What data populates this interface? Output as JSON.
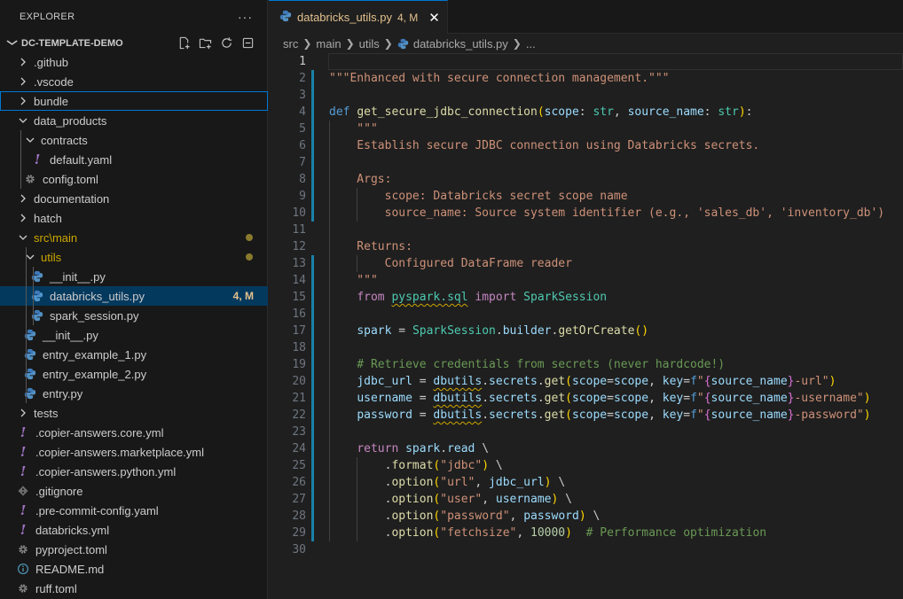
{
  "explorer": {
    "title": "EXPLORER",
    "more": "···",
    "project": "DC-TEMPLATE-DEMO",
    "project_actions": [
      "new-file-icon",
      "new-folder-icon",
      "refresh-icon",
      "collapse-all-icon"
    ]
  },
  "tree": [
    {
      "label": ".github",
      "type": "folder",
      "depth": 0,
      "expanded": false
    },
    {
      "label": ".vscode",
      "type": "folder",
      "depth": 0,
      "expanded": false
    },
    {
      "label": "bundle",
      "type": "folder",
      "depth": 0,
      "expanded": false,
      "focused": true
    },
    {
      "label": "data_products",
      "type": "folder",
      "depth": 0,
      "expanded": true
    },
    {
      "label": "contracts",
      "type": "folder",
      "depth": 1,
      "expanded": true
    },
    {
      "label": "default.yaml",
      "type": "yaml",
      "depth": 2
    },
    {
      "label": "config.toml",
      "type": "toml",
      "depth": 1
    },
    {
      "label": "documentation",
      "type": "folder",
      "depth": 0,
      "expanded": false
    },
    {
      "label": "hatch",
      "type": "folder",
      "depth": 0,
      "expanded": false
    },
    {
      "label": "src\\main",
      "type": "folder",
      "depth": 0,
      "expanded": true,
      "modified": true,
      "dot": true
    },
    {
      "label": "utils",
      "type": "folder",
      "depth": 1,
      "expanded": true,
      "modified": true,
      "dot": true
    },
    {
      "label": "__init__.py",
      "type": "py",
      "depth": 2
    },
    {
      "label": "databricks_utils.py",
      "type": "py",
      "depth": 2,
      "selected": true,
      "badge": "4, M"
    },
    {
      "label": "spark_session.py",
      "type": "py",
      "depth": 2
    },
    {
      "label": "__init__.py",
      "type": "py",
      "depth": 1
    },
    {
      "label": "entry_example_1.py",
      "type": "py",
      "depth": 1
    },
    {
      "label": "entry_example_2.py",
      "type": "py",
      "depth": 1
    },
    {
      "label": "entry.py",
      "type": "py",
      "depth": 1
    },
    {
      "label": "tests",
      "type": "folder",
      "depth": 0,
      "expanded": false
    },
    {
      "label": ".copier-answers.core.yml",
      "type": "yaml",
      "depth": 0
    },
    {
      "label": ".copier-answers.marketplace.yml",
      "type": "yaml",
      "depth": 0
    },
    {
      "label": ".copier-answers.python.yml",
      "type": "yaml",
      "depth": 0
    },
    {
      "label": ".gitignore",
      "type": "git",
      "depth": 0
    },
    {
      "label": ".pre-commit-config.yaml",
      "type": "yaml",
      "depth": 0
    },
    {
      "label": "databricks.yml",
      "type": "yaml",
      "depth": 0
    },
    {
      "label": "pyproject.toml",
      "type": "toml",
      "depth": 0
    },
    {
      "label": "README.md",
      "type": "info",
      "depth": 0
    },
    {
      "label": "ruff.toml",
      "type": "toml",
      "depth": 0
    }
  ],
  "tab": {
    "label": "databricks_utils.py",
    "badge": "4, M",
    "close": "✕"
  },
  "breadcrumb": [
    "src",
    "main",
    "utils",
    "databricks_utils.py",
    "..."
  ],
  "editor": {
    "current_line": 1,
    "lines": [
      [],
      [
        [
          "str",
          "\"\"\"Enhanced with secure connection management.\"\"\""
        ]
      ],
      [],
      [
        [
          "kw",
          "def"
        ],
        [
          "",
          " "
        ],
        [
          "fn",
          "get_secure_jdbc_connection"
        ],
        [
          "br1",
          "("
        ],
        [
          "prm",
          "scope"
        ],
        [
          "",
          ": "
        ],
        [
          "ty",
          "str"
        ],
        [
          "",
          ", "
        ],
        [
          "prm",
          "source_name"
        ],
        [
          "",
          ": "
        ],
        [
          "ty",
          "str"
        ],
        [
          "br1",
          ")"
        ],
        [
          "",
          ":"
        ]
      ],
      [
        [
          "str",
          "    \"\"\""
        ]
      ],
      [
        [
          "str",
          "    Establish secure JDBC connection using Databricks secrets."
        ]
      ],
      [],
      [
        [
          "str",
          "    Args:"
        ]
      ],
      [
        [
          "str",
          "        scope: Databricks secret scope name"
        ]
      ],
      [
        [
          "str",
          "        source_name: Source system identifier (e.g., 'sales_db', 'inventory_db')"
        ]
      ],
      [],
      [
        [
          "str",
          "    Returns:"
        ]
      ],
      [
        [
          "str",
          "        Configured DataFrame reader"
        ]
      ],
      [
        [
          "str",
          "    \"\"\""
        ]
      ],
      [
        [
          "",
          "    "
        ],
        [
          "kw2",
          "from"
        ],
        [
          "",
          " "
        ],
        [
          "ty sq",
          "pyspark.sql"
        ],
        [
          "",
          " "
        ],
        [
          "kw2",
          "import"
        ],
        [
          "",
          " "
        ],
        [
          "ty",
          "SparkSession"
        ]
      ],
      [],
      [
        [
          "",
          "    "
        ],
        [
          "prm",
          "spark"
        ],
        [
          "",
          " = "
        ],
        [
          "ty",
          "SparkSession"
        ],
        [
          "",
          "."
        ],
        [
          "prm",
          "builder"
        ],
        [
          "",
          "."
        ],
        [
          "fn",
          "getOrCreate"
        ],
        [
          "br1",
          "()"
        ]
      ],
      [],
      [
        [
          "cm",
          "    # Retrieve credentials from secrets (never hardcode!)"
        ]
      ],
      [
        [
          "",
          "    "
        ],
        [
          "prm",
          "jdbc_url"
        ],
        [
          "",
          " = "
        ],
        [
          "prm sq",
          "dbutils"
        ],
        [
          "",
          "."
        ],
        [
          "prm",
          "secrets"
        ],
        [
          "",
          "."
        ],
        [
          "fn",
          "get"
        ],
        [
          "br1",
          "("
        ],
        [
          "prm",
          "scope"
        ],
        [
          "",
          "="
        ],
        [
          "prm",
          "scope"
        ],
        [
          "",
          ", "
        ],
        [
          "prm",
          "key"
        ],
        [
          "",
          "="
        ],
        [
          "kw",
          "f"
        ],
        [
          "str",
          "\""
        ],
        [
          "br2",
          "{"
        ],
        [
          "prm",
          "source_name"
        ],
        [
          "br2",
          "}"
        ],
        [
          "str",
          "-url\""
        ],
        [
          "br1",
          ")"
        ]
      ],
      [
        [
          "",
          "    "
        ],
        [
          "prm",
          "username"
        ],
        [
          "",
          " = "
        ],
        [
          "prm sq",
          "dbutils"
        ],
        [
          "",
          "."
        ],
        [
          "prm",
          "secrets"
        ],
        [
          "",
          "."
        ],
        [
          "fn",
          "get"
        ],
        [
          "br1",
          "("
        ],
        [
          "prm",
          "scope"
        ],
        [
          "",
          "="
        ],
        [
          "prm",
          "scope"
        ],
        [
          "",
          ", "
        ],
        [
          "prm",
          "key"
        ],
        [
          "",
          "="
        ],
        [
          "kw",
          "f"
        ],
        [
          "str",
          "\""
        ],
        [
          "br2",
          "{"
        ],
        [
          "prm",
          "source_name"
        ],
        [
          "br2",
          "}"
        ],
        [
          "str",
          "-username\""
        ],
        [
          "br1",
          ")"
        ]
      ],
      [
        [
          "",
          "    "
        ],
        [
          "prm",
          "password"
        ],
        [
          "",
          " = "
        ],
        [
          "prm sq",
          "dbutils"
        ],
        [
          "",
          "."
        ],
        [
          "prm",
          "secrets"
        ],
        [
          "",
          "."
        ],
        [
          "fn",
          "get"
        ],
        [
          "br1",
          "("
        ],
        [
          "prm",
          "scope"
        ],
        [
          "",
          "="
        ],
        [
          "prm",
          "scope"
        ],
        [
          "",
          ", "
        ],
        [
          "prm",
          "key"
        ],
        [
          "",
          "="
        ],
        [
          "kw",
          "f"
        ],
        [
          "str",
          "\""
        ],
        [
          "br2",
          "{"
        ],
        [
          "prm",
          "source_name"
        ],
        [
          "br2",
          "}"
        ],
        [
          "str",
          "-password\""
        ],
        [
          "br1",
          ")"
        ]
      ],
      [],
      [
        [
          "",
          "    "
        ],
        [
          "kw2",
          "return"
        ],
        [
          "",
          " "
        ],
        [
          "prm",
          "spark"
        ],
        [
          "",
          "."
        ],
        [
          "prm",
          "read"
        ],
        [
          "",
          " \\"
        ]
      ],
      [
        [
          "",
          "        ."
        ],
        [
          "fn",
          "format"
        ],
        [
          "br1",
          "("
        ],
        [
          "str",
          "\"jdbc\""
        ],
        [
          "br1",
          ")"
        ],
        [
          "",
          " \\"
        ]
      ],
      [
        [
          "",
          "        ."
        ],
        [
          "fn",
          "option"
        ],
        [
          "br1",
          "("
        ],
        [
          "str",
          "\"url\""
        ],
        [
          "",
          ", "
        ],
        [
          "prm",
          "jdbc_url"
        ],
        [
          "br1",
          ")"
        ],
        [
          "",
          " \\"
        ]
      ],
      [
        [
          "",
          "        ."
        ],
        [
          "fn",
          "option"
        ],
        [
          "br1",
          "("
        ],
        [
          "str",
          "\"user\""
        ],
        [
          "",
          ", "
        ],
        [
          "prm",
          "username"
        ],
        [
          "br1",
          ")"
        ],
        [
          "",
          " \\"
        ]
      ],
      [
        [
          "",
          "        ."
        ],
        [
          "fn",
          "option"
        ],
        [
          "br1",
          "("
        ],
        [
          "str",
          "\"password\""
        ],
        [
          "",
          ", "
        ],
        [
          "prm",
          "password"
        ],
        [
          "br1",
          ")"
        ],
        [
          "",
          " \\"
        ]
      ],
      [
        [
          "",
          "        ."
        ],
        [
          "fn",
          "option"
        ],
        [
          "br1",
          "("
        ],
        [
          "str",
          "\"fetchsize\""
        ],
        [
          "",
          ", "
        ],
        [
          "num",
          "10000"
        ],
        [
          "br1",
          ")"
        ],
        [
          "",
          "  "
        ],
        [
          "cm",
          "# Performance optimization"
        ]
      ],
      []
    ]
  }
}
